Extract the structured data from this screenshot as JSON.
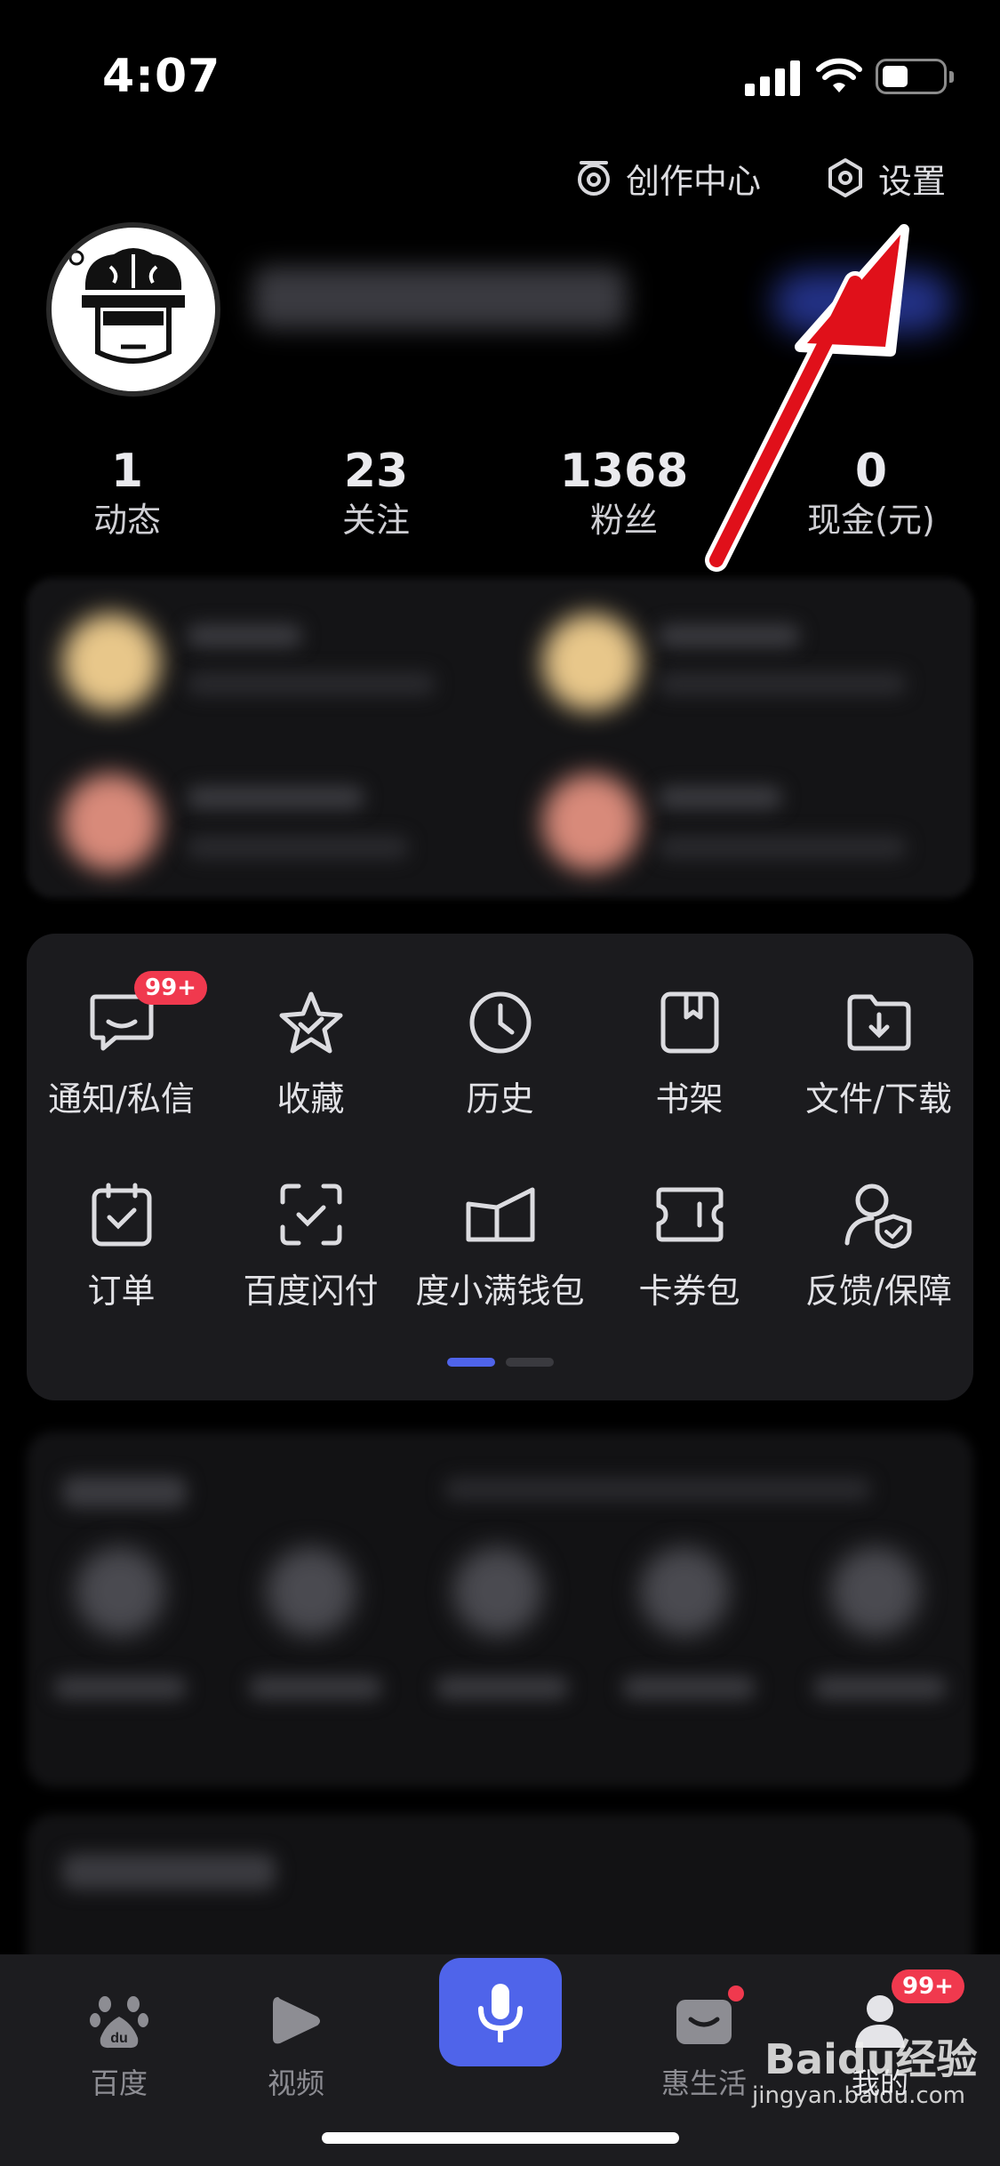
{
  "status_bar": {
    "time": "4:07"
  },
  "header": {
    "creator_center": "创作中心",
    "settings": "设置"
  },
  "stats": [
    {
      "value": "1",
      "label": "动态"
    },
    {
      "value": "23",
      "label": "关注"
    },
    {
      "value": "1368",
      "label": "粉丝"
    },
    {
      "value": "0",
      "label": "现金(元)"
    }
  ],
  "menu": {
    "row1": [
      {
        "label": "通知/私信",
        "icon": "message-icon",
        "badge": "99+"
      },
      {
        "label": "收藏",
        "icon": "star-icon"
      },
      {
        "label": "历史",
        "icon": "clock-icon"
      },
      {
        "label": "书架",
        "icon": "bookmark-icon"
      },
      {
        "label": "文件/下载",
        "icon": "folder-download-icon"
      }
    ],
    "row2": [
      {
        "label": "订单",
        "icon": "calendar-check-icon"
      },
      {
        "label": "百度闪付",
        "icon": "scan-pay-icon"
      },
      {
        "label": "度小满钱包",
        "icon": "wallet-icon"
      },
      {
        "label": "卡券包",
        "icon": "ticket-icon"
      },
      {
        "label": "反馈/保障",
        "icon": "user-shield-icon"
      }
    ]
  },
  "tabbar": {
    "baidu": "百度",
    "video": "视频",
    "life": "惠生活",
    "mine": "我的",
    "mine_badge": "99+"
  },
  "watermark": {
    "text": "Baidu经验",
    "sub": "jingyan.baidu.com"
  },
  "colors": {
    "accent": "#4f64ea",
    "badge": "#f0394e",
    "arrow": "#e0101a"
  }
}
